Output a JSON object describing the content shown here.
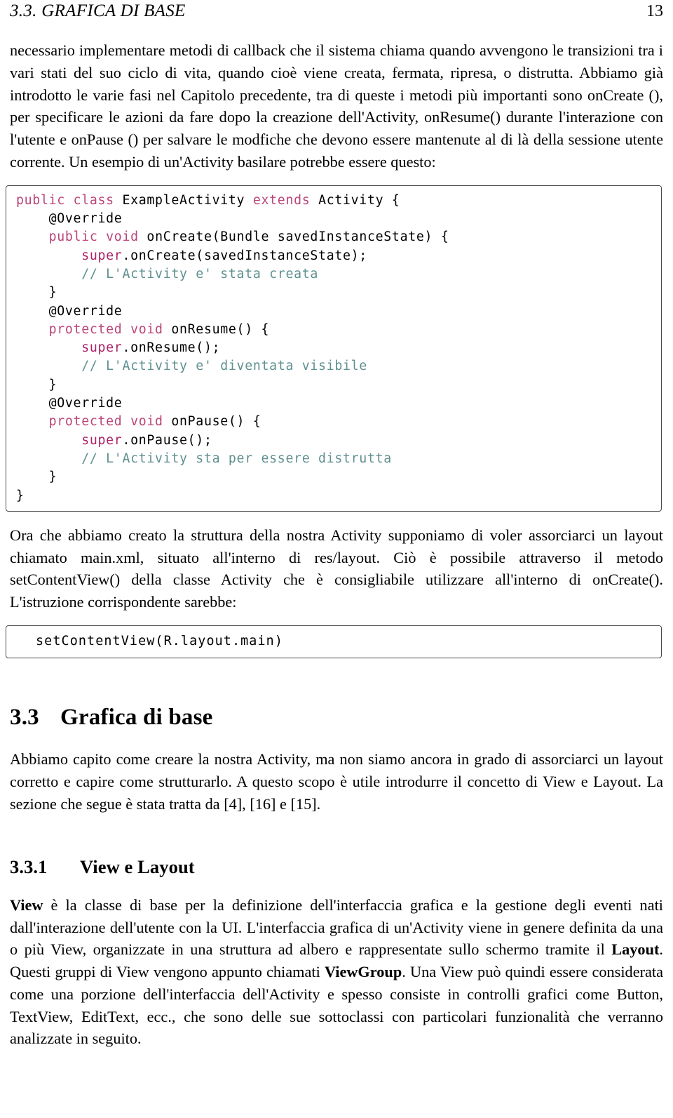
{
  "header": {
    "section_label": "3.3.  GRAFICA DI BASE",
    "page_number": "13"
  },
  "paragraphs": {
    "intro": "necessario implementare metodi di callback che il sistema chiama quando avvengono le transizioni tra i vari stati del suo ciclo di vita, quando cioè viene creata, fermata, ripresa, o distrutta. Abbiamo già introdotto le varie fasi nel Capitolo precedente, tra di queste i metodi più importanti sono onCreate (), per specificare le azioni da fare dopo la creazione dell'Activity, onResume() durante l'interazione con l'utente e onPause () per salvare le modfiche che devono essere mantenute al di là della sessione utente corrente. Un esempio di un'Activity basilare potrebbe essere questo:",
    "after_code": "Ora che abbiamo creato la struttura della nostra Activity supponiamo di voler assorciarci un layout chiamato main.xml, situato all'interno di res/layout. Ciò è possibile attraverso il metodo setContentView() della classe Activity che è consigliabile utilizzare all'interno di onCreate(). L'istruzione corrispondente sarebbe:",
    "section_intro": "Abbiamo capito come creare la nostra Activity, ma non siamo ancora in grado di assorciarci un layout corretto e capire come strutturarlo. A questo scopo è utile introdurre il concetto di View e Layout. La sezione che segue è stata tratta da [4], [16] e [15].",
    "view_layout_1": "View",
    "view_layout_2": " è la classe di base per la definizione dell'interfaccia grafica e la gestione degli eventi nati dall'interazione dell'utente con la UI. L'interfaccia grafica di un'Activity viene in genere definita da una o più View, organizzate in una struttura ad albero e rappresentate sullo schermo tramite il ",
    "view_layout_3": "Layout",
    "view_layout_4": ". Questi gruppi di View vengono appunto chiamati ",
    "view_layout_5": "ViewGroup",
    "view_layout_6": ". Una View può quindi essere considerata come una porzione dell'interfaccia dell'Activity e spesso consiste in controlli grafici come Button, TextView, EditText, ecc., che sono delle sue sottoclassi con particolari funzionalità che verranno analizzate in seguito."
  },
  "headings": {
    "section_number": "3.3",
    "section_title": "Grafica di base",
    "subsection_number": "3.3.1",
    "subsection_title": "View e Layout"
  },
  "code_block_main": {
    "language": "java",
    "lines": [
      [
        {
          "t": "public class ",
          "c": "kw"
        },
        {
          "t": "ExampleActivity ",
          "c": "id"
        },
        {
          "t": "extends ",
          "c": "kw"
        },
        {
          "t": "Activity {",
          "c": "id"
        }
      ],
      [
        {
          "t": "    @Override",
          "c": "id"
        }
      ],
      [
        {
          "t": "    ",
          "c": "id"
        },
        {
          "t": "public void ",
          "c": "kw"
        },
        {
          "t": "onCreate(Bundle savedInstanceState) {",
          "c": "id"
        }
      ],
      [
        {
          "t": "        ",
          "c": "id"
        },
        {
          "t": "super",
          "c": "kw2"
        },
        {
          "t": ".onCreate(savedInstanceState);",
          "c": "id"
        }
      ],
      [
        {
          "t": "        // L'Activity e' stata creata",
          "c": "cmt"
        }
      ],
      [
        {
          "t": "    }",
          "c": "id"
        }
      ],
      [
        {
          "t": "    @Override",
          "c": "id"
        }
      ],
      [
        {
          "t": "    ",
          "c": "id"
        },
        {
          "t": "protected void ",
          "c": "kw"
        },
        {
          "t": "onResume() {",
          "c": "id"
        }
      ],
      [
        {
          "t": "        ",
          "c": "id"
        },
        {
          "t": "super",
          "c": "kw2"
        },
        {
          "t": ".onResume();",
          "c": "id"
        }
      ],
      [
        {
          "t": "        // L'Activity e' diventata visibile",
          "c": "cmt"
        }
      ],
      [
        {
          "t": "    }",
          "c": "id"
        }
      ],
      [
        {
          "t": "    @Override",
          "c": "id"
        }
      ],
      [
        {
          "t": "    ",
          "c": "id"
        },
        {
          "t": "protected void ",
          "c": "kw"
        },
        {
          "t": "onPause() {",
          "c": "id"
        }
      ],
      [
        {
          "t": "        ",
          "c": "id"
        },
        {
          "t": "super",
          "c": "kw2"
        },
        {
          "t": ".onPause();",
          "c": "id"
        }
      ],
      [
        {
          "t": "        // L'Activity sta per essere distrutta",
          "c": "cmt"
        }
      ],
      [
        {
          "t": "    }",
          "c": "id"
        }
      ],
      [
        {
          "t": "}",
          "c": "id"
        }
      ]
    ]
  },
  "code_block_single": {
    "text": "setContentView(R.layout.main)"
  },
  "colors": {
    "keyword": "#bb4477",
    "keyword_super": "#aa2266",
    "comment": "#5f8f8f",
    "identifier": "#000000",
    "code_border": "#4a4a4a",
    "text": "#000000",
    "background": "#ffffff"
  }
}
